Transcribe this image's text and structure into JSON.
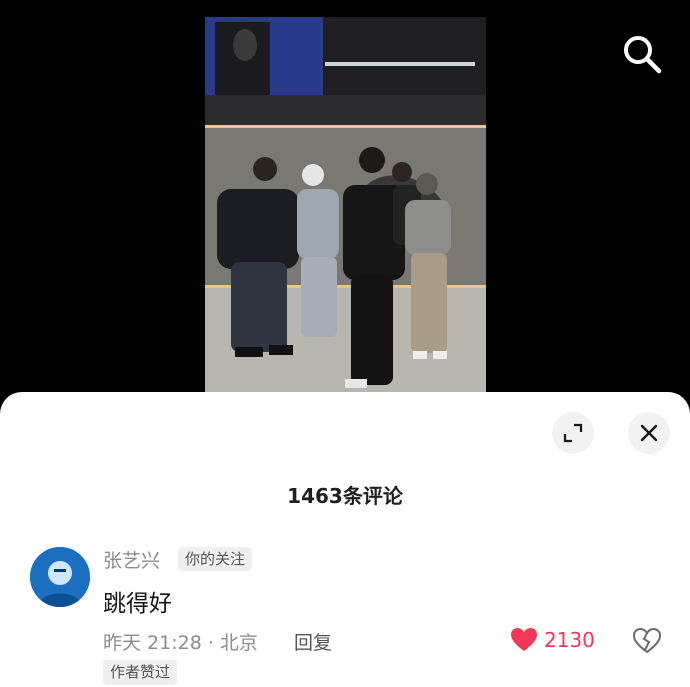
{
  "video": {
    "search_icon": "search-icon"
  },
  "sheet": {
    "expand_icon": "expand-icon",
    "close_icon": "close-icon",
    "comment_count_title": "1463条评论"
  },
  "comment": {
    "author": "张艺兴",
    "follow_badge": "你的关注",
    "text": "跳得好",
    "time_location": "昨天 21:28 · 北京",
    "reply_label": "回复",
    "like_count": "2130",
    "author_liked_badge": "作者赞过"
  },
  "colors": {
    "like": "#f23758",
    "sheet_background": "#ffffff",
    "video_background": "#000000"
  }
}
